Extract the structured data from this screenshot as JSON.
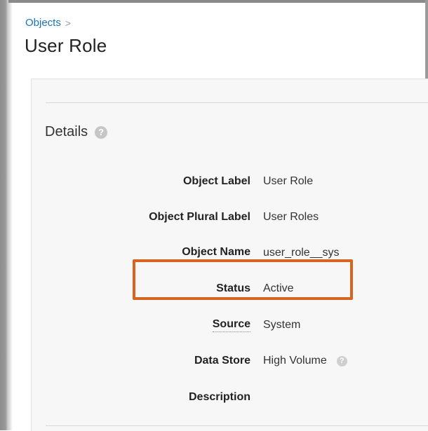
{
  "breadcrumb": {
    "parent_label": "Objects",
    "separator": ">"
  },
  "page": {
    "title": "User Role"
  },
  "details": {
    "section_title": "Details",
    "help_icon": "question-circle-icon",
    "fields": [
      {
        "label": "Object Label",
        "value": "User Role",
        "dotted": false
      },
      {
        "label": "Object Plural Label",
        "value": "User Roles",
        "dotted": false
      },
      {
        "label": "Object Name",
        "value": "user_role__sys",
        "dotted": true
      },
      {
        "label": "Status",
        "value": "Active",
        "dotted": false
      },
      {
        "label": "Source",
        "value": "System",
        "dotted": true
      },
      {
        "label": "Data Store",
        "value": "High Volume",
        "dotted": false,
        "has_help": true,
        "highlighted": true
      },
      {
        "label": "Description",
        "value": "",
        "dotted": false
      }
    ]
  },
  "colors": {
    "link": "#1a73b8",
    "highlight": "#d5651f",
    "panel_bg": "#f7f7f7"
  }
}
